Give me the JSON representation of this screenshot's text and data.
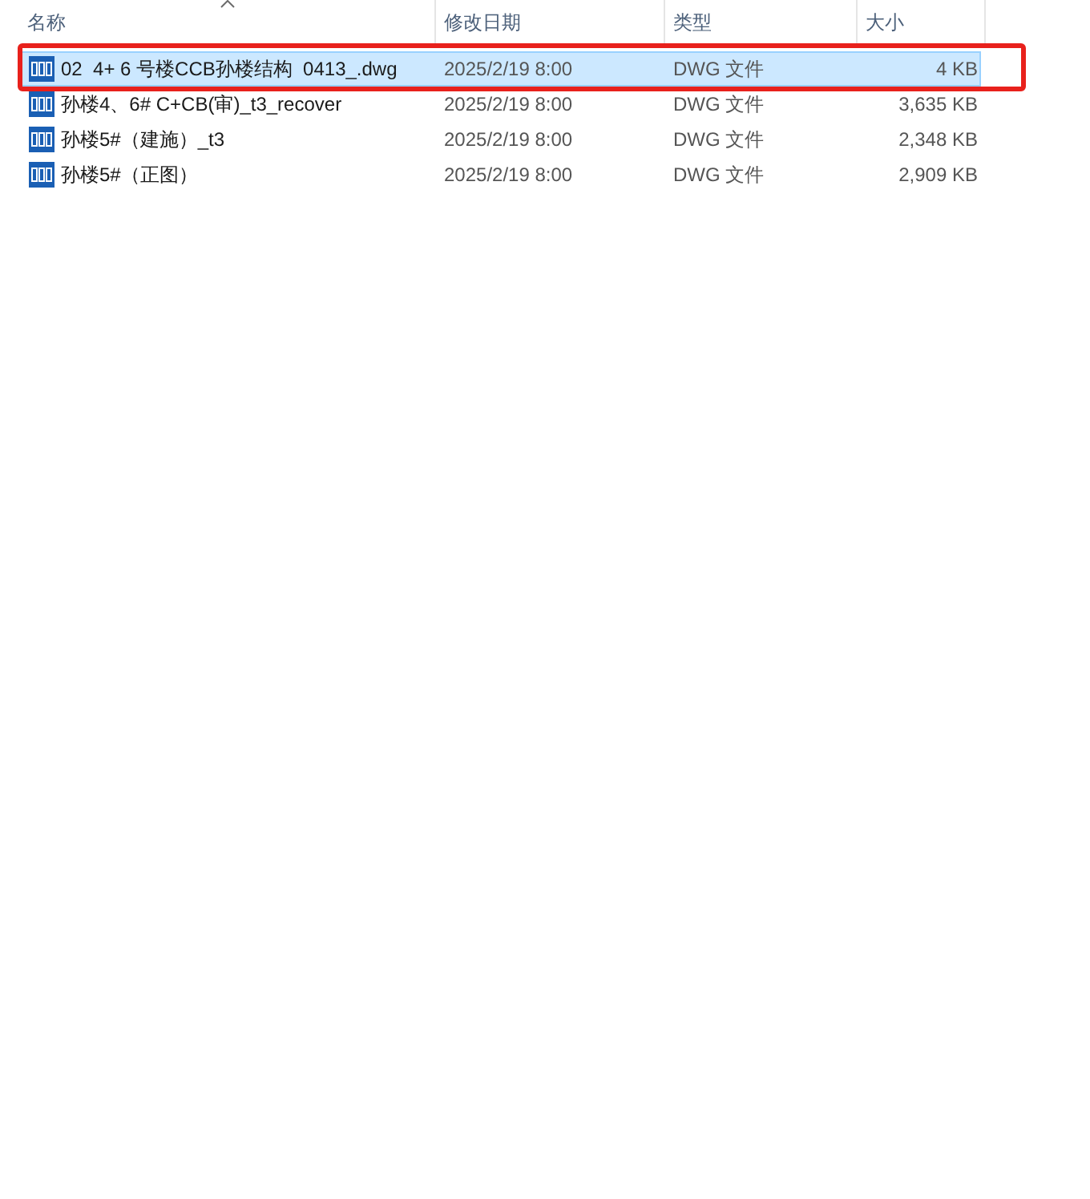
{
  "columns": [
    {
      "label": "名称",
      "sorted": true
    },
    {
      "label": "修改日期",
      "sorted": false
    },
    {
      "label": "类型",
      "sorted": false
    },
    {
      "label": "大小",
      "sorted": false
    }
  ],
  "rows": [
    {
      "name": "02  4+ 6 号楼CCB孙楼结构  0413_.dwg",
      "date": "2025/2/19 8:00",
      "type": "DWG 文件",
      "size": "4 KB",
      "selected": true
    },
    {
      "name": "孙楼4、6# C+CB(审)_t3_recover",
      "date": "2025/2/19 8:00",
      "type": "DWG 文件",
      "size": "3,635 KB",
      "selected": false
    },
    {
      "name": "孙楼5#（建施）_t3",
      "date": "2025/2/19 8:00",
      "type": "DWG 文件",
      "size": "2,348 KB",
      "selected": false
    },
    {
      "name": "孙楼5#（正图）",
      "date": "2025/2/19 8:00",
      "type": "DWG 文件",
      "size": "2,909 KB",
      "selected": false
    }
  ],
  "annotation": {
    "shown": true
  }
}
